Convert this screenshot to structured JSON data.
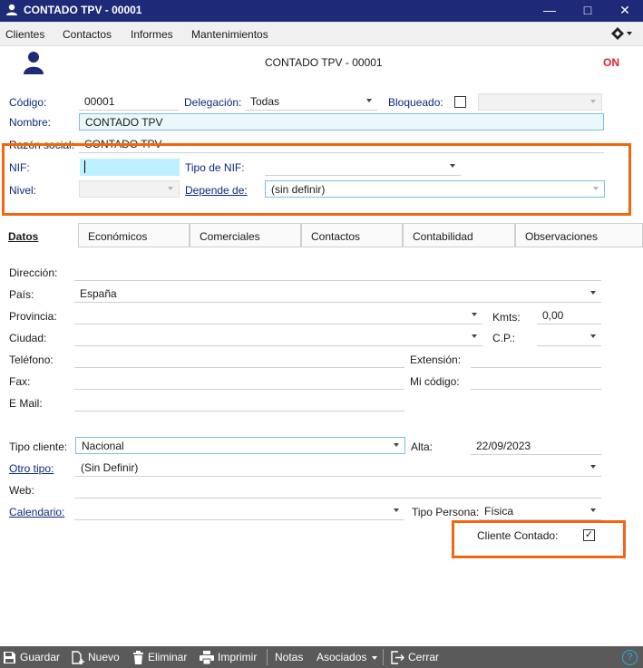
{
  "window": {
    "title": "CONTADO TPV - 00001",
    "minimize": "—",
    "maximize": "□",
    "close": "✕"
  },
  "menu": [
    "Clientes",
    "Contactos",
    "Informes",
    "Mantenimientos"
  ],
  "header": {
    "record_title": "CONTADO TPV - 00001",
    "status": "ON",
    "status_color": "#e0202a"
  },
  "general": {
    "codigo_label": "Código:",
    "codigo_value": "00001",
    "delegacion_label": "Delegación:",
    "delegacion_value": "Todas",
    "bloqueado_label": "Bloqueado:",
    "nombre_label": "Nombre:",
    "nombre_value": "CONTADO TPV",
    "razon_label": "Razón social:",
    "razon_value": "CONTADO TPV",
    "nif_label": "NIF:",
    "nif_value": "",
    "tipo_nif_label": "Tipo de NIF:",
    "tipo_nif_value": "",
    "nivel_label": "Nivel:",
    "depende_label": "Depende de:",
    "depende_value": "(sin definir)"
  },
  "tabs": [
    "Datos",
    "Económicos",
    "Comerciales",
    "Contactos",
    "Contabilidad",
    "Observaciones"
  ],
  "datos": {
    "direccion_label": "Dirección:",
    "pais_label": "País:",
    "pais_value": "España",
    "provincia_label": "Provincia:",
    "kmts_label": "Kmts:",
    "kmts_value": "0,00",
    "ciudad_label": "Ciudad:",
    "cp_label": "C.P.:",
    "telefono_label": "Teléfono:",
    "extension_label": "Extensión:",
    "fax_label": "Fax:",
    "micodigo_label": "Mi código:",
    "email_label": "E Mail:",
    "tipo_cliente_label": "Tipo cliente:",
    "tipo_cliente_value": "Nacional",
    "alta_label": "Alta:",
    "alta_value": "22/09/2023",
    "otro_tipo_label": "Otro tipo:",
    "otro_tipo_value": "(Sin Definir)",
    "web_label": "Web:",
    "calendario_label": "Calendario:",
    "tipo_persona_label": "Tipo Persona:",
    "tipo_persona_value": "Física",
    "cliente_contado_label": "Cliente Contado:",
    "cliente_contado_checked": "✓"
  },
  "toolbar": {
    "guardar": "Guardar",
    "nuevo": "Nuevo",
    "eliminar": "Eliminar",
    "imprimir": "Imprimir",
    "notas": "Notas",
    "asociados": "Asociados",
    "cerrar": "Cerrar",
    "help": "?"
  },
  "colors": {
    "titlebar": "#1e2a78",
    "highlight": "#f0670f",
    "toolbar": "#5a5a5a"
  }
}
